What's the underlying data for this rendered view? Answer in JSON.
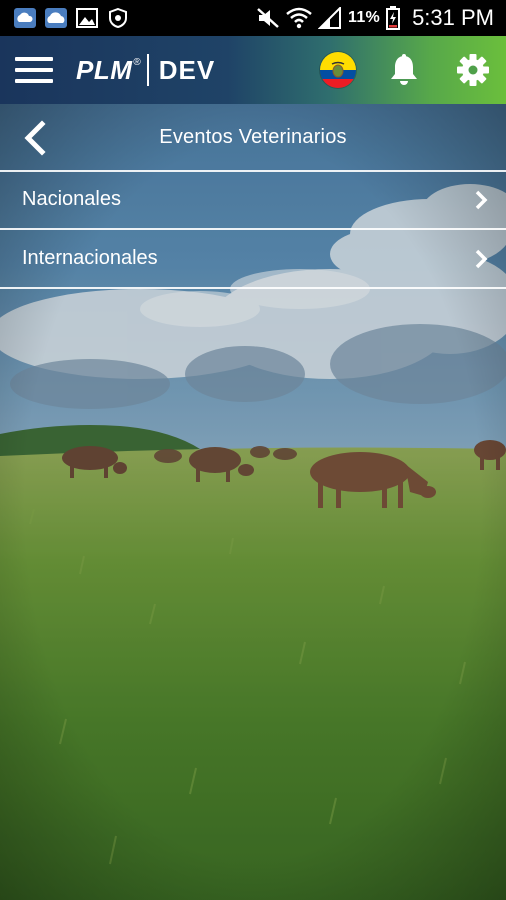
{
  "status_bar": {
    "battery_percent": "11%",
    "time": "5:31 PM",
    "icons": [
      "cloud-upload-icon",
      "cloud-sync-icon",
      "image-icon",
      "shield-icon",
      "mute-icon",
      "wifi-icon",
      "signal-icon",
      "battery-icon"
    ]
  },
  "app_bar": {
    "logo_brand": "PLM",
    "logo_registered": "®",
    "logo_edition": "DEV",
    "country_flag": "ecuador-flag-icon",
    "notification_icon": "bell-icon",
    "settings_icon": "gear-icon",
    "gradient_colors": [
      "#1a355c",
      "#6bbf3c"
    ]
  },
  "header": {
    "title": "Eventos Veterinarios",
    "back_icon": "chevron-left-icon"
  },
  "list": {
    "items": [
      {
        "label": "Nacionales"
      },
      {
        "label": "Internacionales"
      }
    ]
  }
}
